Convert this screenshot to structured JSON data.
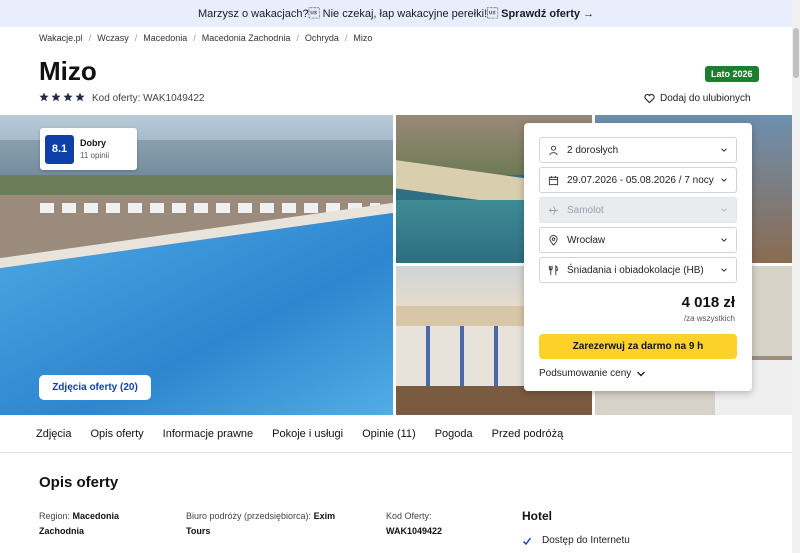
{
  "promo": {
    "text": "Marzysz o wakacjach?\u001f Nie czekaj, łap wakacyjne perełki!\u001f",
    "link": "Sprawdź oferty →"
  },
  "breadcrumb": [
    "Wakacje.pl",
    "Wczasy",
    "Macedonia",
    "Macedonia Zachodnia",
    "Ochryda",
    "Mizo"
  ],
  "hotel": {
    "name": "Mizo",
    "season_badge": "Lato 2026",
    "stars": 4,
    "offer_code": "Kod oferty: WAK1049422",
    "favorite_label": "Dodaj do ulubionych"
  },
  "rating": {
    "score": "8.1",
    "label": "Dobry",
    "reviews": "11 opinii"
  },
  "photos_button": "Zdjęcia oferty (20)",
  "booking": {
    "guests": "2 dorosłych",
    "dates": "29.07.2026 - 05.08.2026 / 7 nocy",
    "transport": "Samolot",
    "departure": "Wrocław",
    "board": "Śniadania i obiadokolacje (HB)",
    "price": "4 018 zł",
    "price_note": "/za wszystkich",
    "book_label": "Zarezerwuj za darmo na 9 h",
    "summary_label": "Podsumowanie ceny"
  },
  "tabs": [
    "Zdjęcia",
    "Opis oferty",
    "Informacje prawne",
    "Pokoje i usługi",
    "Opinie (11)",
    "Pogoda",
    "Przed podróżą"
  ],
  "description": {
    "title": "Opis oferty",
    "region_label": "Region:",
    "region_value_1": "Macedonia",
    "region_value_2": "Zachodnia",
    "organizer_label": "Biuro podróży (przedsiębiorca):",
    "organizer_value_1": "Exim",
    "organizer_value_2": "Tours",
    "code_label": "Kod Oferty:",
    "code_value": "WAK1049422",
    "hotel_heading": "Hotel",
    "features": [
      "Dostęp do Internetu"
    ]
  },
  "colors": {
    "accent": "#0f3fa8",
    "cta": "#fcd12a",
    "badge": "#1a7f2e",
    "promo_bg": "#e8eefc"
  }
}
